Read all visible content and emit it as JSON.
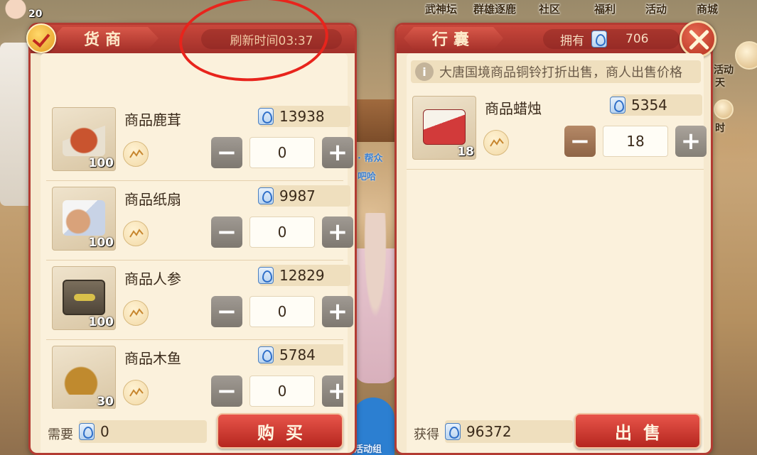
{
  "player": {
    "level": "20"
  },
  "topnav": [
    "武神坛",
    "群雄逐鹿",
    "社区",
    "福利",
    "活动",
    "商城"
  ],
  "scene_texts": {
    "guild": "· 帮众",
    "name": "吧哈",
    "bottom": "活动组"
  },
  "side": {
    "activity": "活动",
    "sky": "天",
    "time": "时"
  },
  "merchant": {
    "title": "货商",
    "refresh_label": "刷新时间03:37",
    "items": [
      {
        "name": "商品鹿茸",
        "price": "13938",
        "stock": "100",
        "qty": "0",
        "icon": "antler-icon",
        "art_color": "#c9542f"
      },
      {
        "name": "商品纸扇",
        "price": "9987",
        "stock": "100",
        "qty": "0",
        "icon": "fan-icon",
        "art_color": "#d9a27a"
      },
      {
        "name": "商品人参",
        "price": "12829",
        "stock": "100",
        "qty": "0",
        "icon": "ginseng-icon",
        "art_color": "#6b6152"
      },
      {
        "name": "商品木鱼",
        "price": "5784",
        "stock": "30",
        "qty": "0",
        "icon": "wooden-fish-icon",
        "art_color": "#c08a2e"
      }
    ],
    "footer": {
      "need_label": "需要",
      "need_value": "0",
      "buy_label": "购买"
    }
  },
  "bag": {
    "title": "行囊",
    "own_label": "拥有",
    "own_value": "706",
    "notice": "大唐国境商品铜铃打折出售，商人出售价格",
    "items": [
      {
        "name": "商品蜡烛",
        "price": "5354",
        "stock": "18",
        "qty": "18",
        "icon": "candle-icon",
        "art_color": "#d23a3a"
      }
    ],
    "footer": {
      "gain_label": "获得",
      "gain_value": "96372",
      "sell_label": "出售"
    }
  },
  "colors": {
    "panel_red": "#b33b32",
    "panel_bg": "#f6e9cf",
    "accent_blue": "#2f6fc8",
    "annotation_red": "#e8241c"
  }
}
